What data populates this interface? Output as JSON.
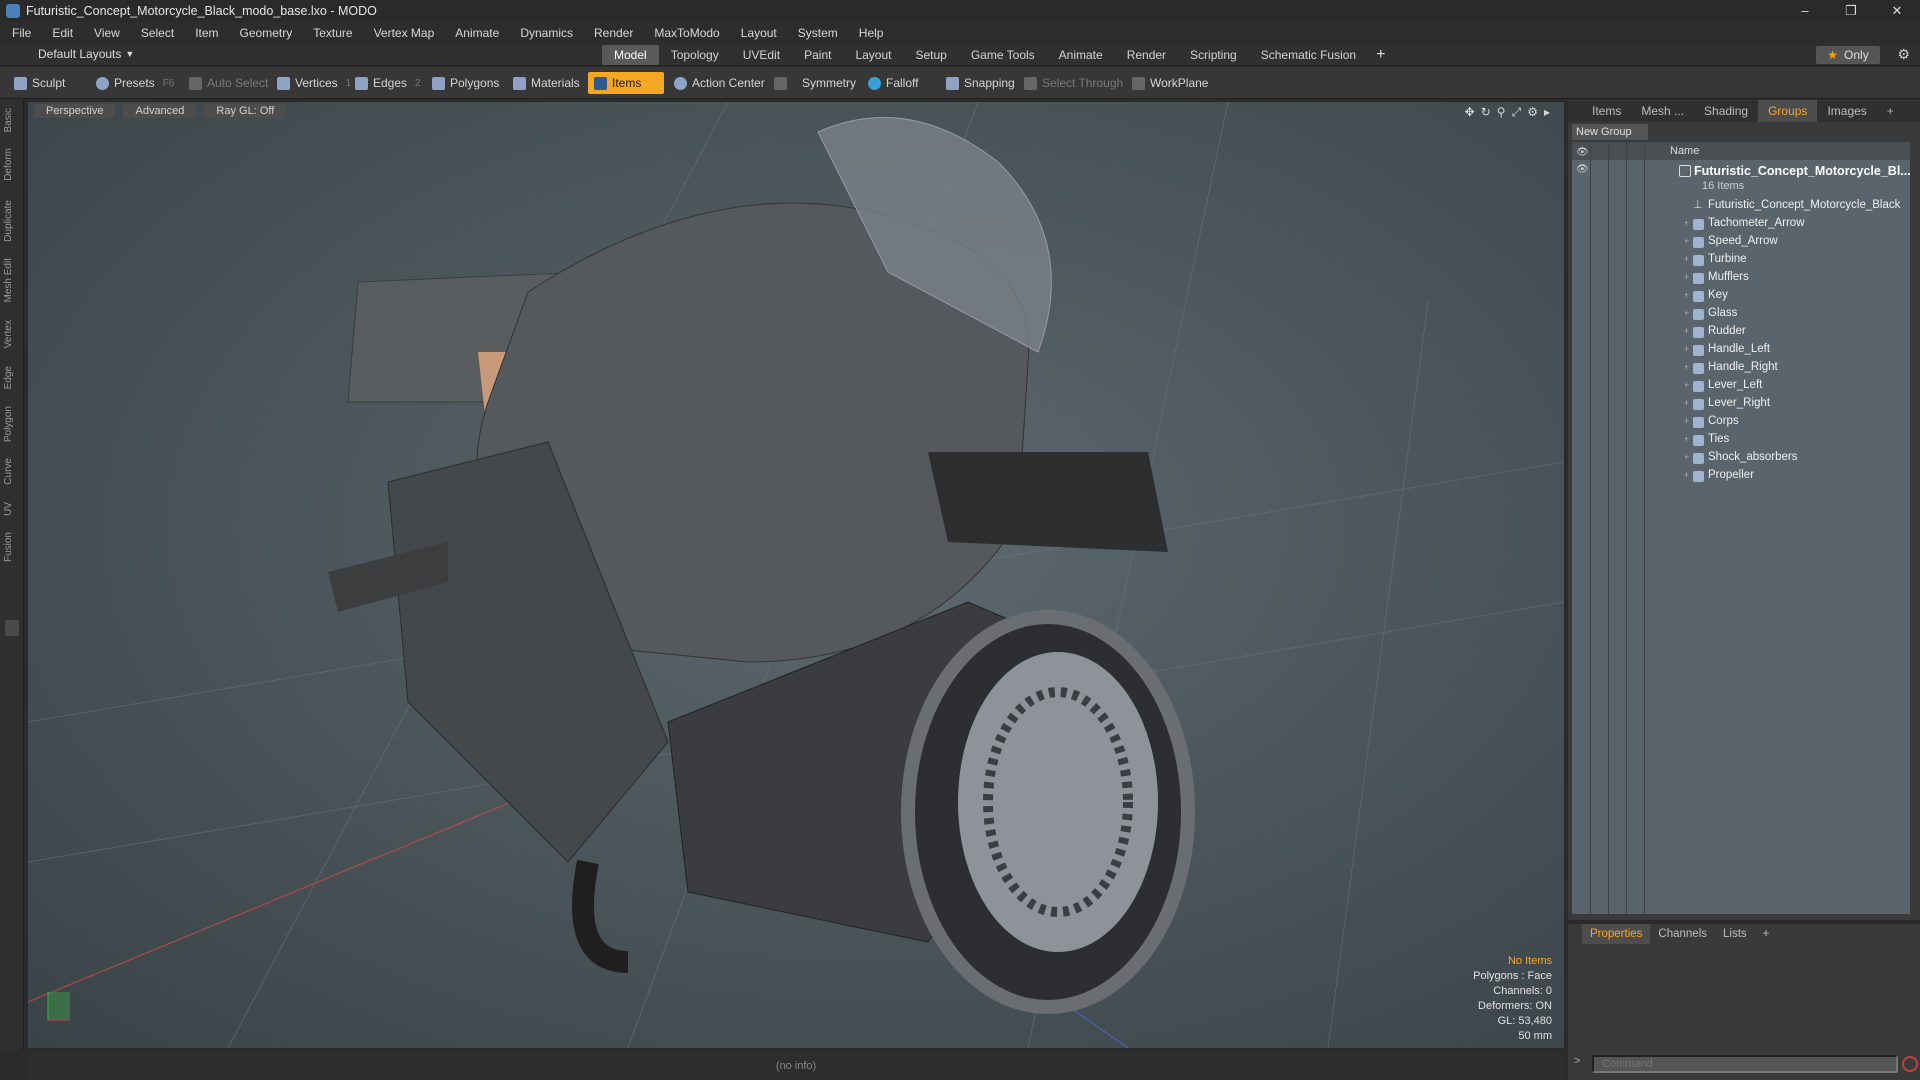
{
  "window": {
    "title": "Futuristic_Concept_Motorcycle_Black_modo_base.lxo - MODO",
    "min": "–",
    "max": "❐",
    "close": "✕"
  },
  "menu": [
    "File",
    "Edit",
    "View",
    "Select",
    "Item",
    "Geometry",
    "Texture",
    "Vertex Map",
    "Animate",
    "Dynamics",
    "Render",
    "MaxToModo",
    "Layout",
    "System",
    "Help"
  ],
  "layoutbar": {
    "layout": "Default Layouts",
    "tabs": [
      "Model",
      "Topology",
      "UVEdit",
      "Paint",
      "Layout",
      "Setup",
      "Game Tools",
      "Animate",
      "Render",
      "Scripting",
      "Schematic Fusion"
    ],
    "active_tab": "Model",
    "plus": "+",
    "only": "Only"
  },
  "toolbar": {
    "sculpt": "Sculpt",
    "presets": "Presets",
    "presets_key": "F6",
    "auto_select": "Auto Select",
    "vertices": "Vertices",
    "vertices_key": "1",
    "edges": "Edges",
    "edges_key": "2",
    "polygons": "Polygons",
    "materials": "Materials",
    "items": "Items",
    "action_center": "Action Center",
    "symmetry": "Symmetry",
    "falloff": "Falloff",
    "snapping": "Snapping",
    "select_through": "Select Through",
    "workplane": "WorkPlane"
  },
  "left_tabs": [
    "Basic",
    "Deform",
    "Duplicate",
    "Mesh Edit",
    "Vertex",
    "Edge",
    "Polygon",
    "Curve",
    "UV",
    "Fusion"
  ],
  "viewport": {
    "view": "Perspective",
    "mode": "Advanced",
    "raygl": "Ray GL: Off",
    "stats": {
      "selection": "No Items",
      "polygons": "Polygons : Face",
      "channels": "Channels: 0",
      "deformers": "Deformers: ON",
      "gl": "GL: 53,480",
      "scale": "50 mm"
    }
  },
  "status": "(no info)",
  "panel": {
    "tabs": [
      "Items",
      "Mesh ...",
      "Shading",
      "Groups",
      "Images"
    ],
    "active_tab": "Groups",
    "new_group": "New Group",
    "col_name": "Name",
    "group_name": "Futuristic_Concept_Motorcycle_Bl...",
    "group_count": "16 Items",
    "items": [
      "Futuristic_Concept_Motorcycle_Black",
      "Tachometer_Arrow",
      "Speed_Arrow",
      "Turbine",
      "Mufflers",
      "Key",
      "Glass",
      "Rudder",
      "Handle_Left",
      "Handle_Right",
      "Lever_Left",
      "Lever_Right",
      "Corps",
      "Ties",
      "Shock_absorbers",
      "Propeller"
    ]
  },
  "props": {
    "tabs": [
      "Properties",
      "Channels",
      "Lists"
    ],
    "active_tab": "Properties",
    "command_placeholder": "Command"
  }
}
